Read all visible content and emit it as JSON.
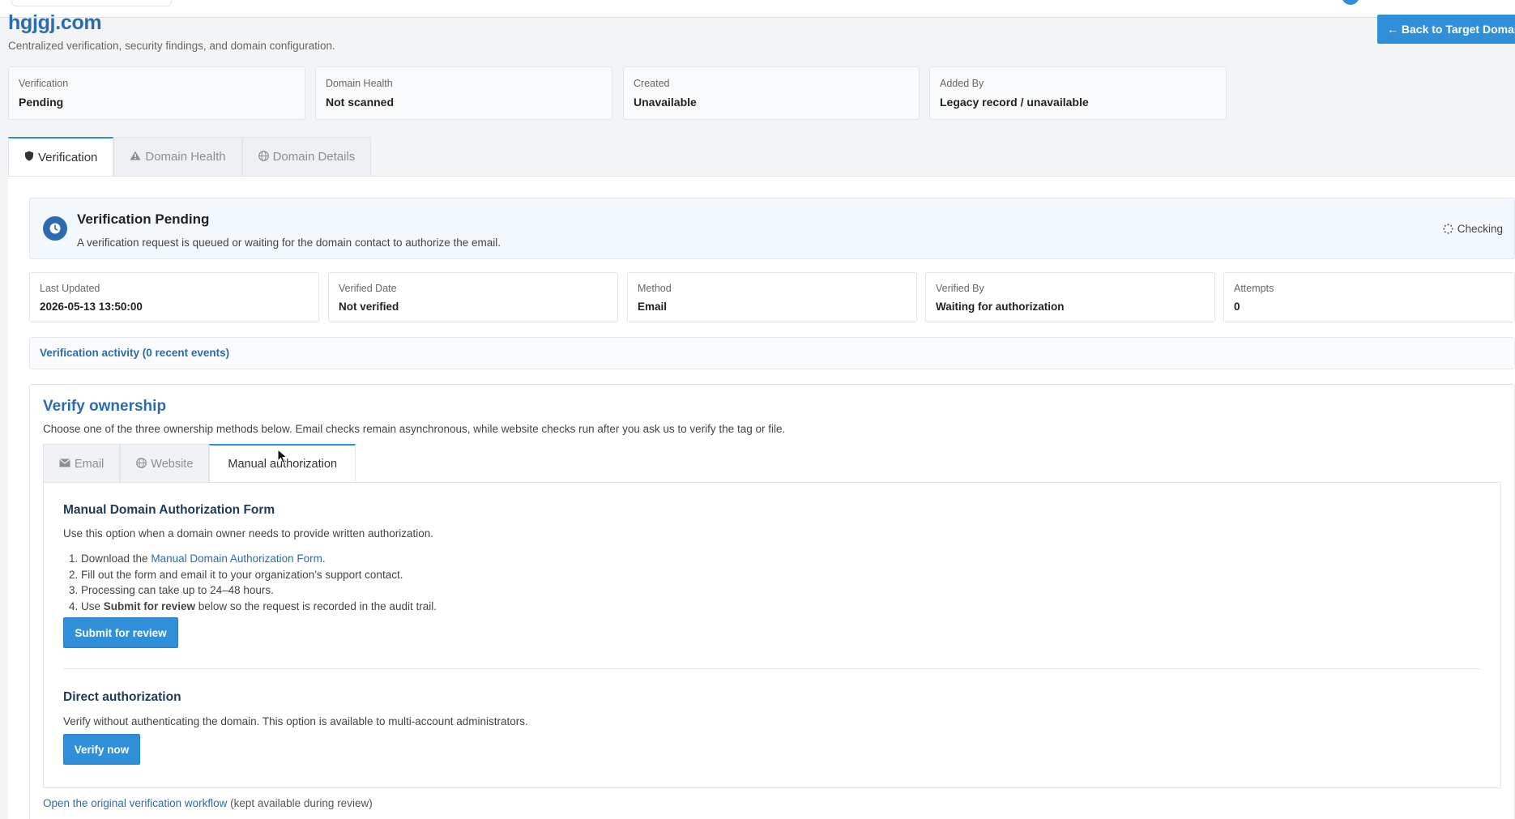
{
  "header": {
    "domain": "hgjgj.com",
    "subtitle": "Centralized verification, security findings, and domain configuration.",
    "back_button": "← Back to Target Domain"
  },
  "summary": [
    {
      "label": "Verification",
      "value": "Pending"
    },
    {
      "label": "Domain Health",
      "value": "Not scanned"
    },
    {
      "label": "Created",
      "value": "Unavailable"
    },
    {
      "label": "Added By",
      "value": "Legacy record / unavailable"
    }
  ],
  "tabs": [
    {
      "label": "Verification",
      "icon": "shield-icon"
    },
    {
      "label": "Domain Health",
      "icon": "warning-icon"
    },
    {
      "label": "Domain Details",
      "icon": "globe-icon"
    }
  ],
  "status": {
    "title": "Verification Pending",
    "description": "A verification request is queued or waiting for the domain contact to authorize the email.",
    "checking": "Checking",
    "icon": "clock-icon"
  },
  "details": [
    {
      "label": "Last Updated",
      "value": "2026-05-13 13:50:00"
    },
    {
      "label": "Verified Date",
      "value": "Not verified"
    },
    {
      "label": "Method",
      "value": "Email"
    },
    {
      "label": "Verified By",
      "value": "Waiting for authorization"
    },
    {
      "label": "Attempts",
      "value": "0"
    }
  ],
  "activity": "Verification activity (0 recent events)",
  "verify": {
    "title": "Verify ownership",
    "subtitle": "Choose one of the three ownership methods below. Email checks remain asynchronous, while website checks run after you ask us to verify the tag or file.",
    "tabs": [
      {
        "label": "Email",
        "icon": "envelope-icon"
      },
      {
        "label": "Website",
        "icon": "globe-icon"
      },
      {
        "label": "Manual authorization",
        "icon": ""
      }
    ],
    "manual": {
      "heading": "Manual Domain Authorization Form",
      "intro": "Use this option when a domain owner needs to provide written authorization.",
      "step1_prefix": "Download the ",
      "step1_link": "Manual Domain Authorization Form",
      "step1_suffix": ".",
      "step2": "Fill out the form and email it to your organization’s support contact.",
      "step3": "Processing can take up to 24–48 hours.",
      "step4_prefix": "Use ",
      "step4_bold": "Submit for review",
      "step4_suffix": " below so the request is recorded in the audit trail.",
      "submit_button": "Submit for review"
    },
    "direct": {
      "heading": "Direct authorization",
      "description": "Verify without authenticating the domain. This option is available to multi-account administrators.",
      "button": "Verify now"
    },
    "footer_link": "Open the original verification workflow",
    "footer_suffix": " (kept available during review)"
  },
  "colors": {
    "accent": "#2f8fd8",
    "title_blue": "#2b6cb0",
    "background": "#f3f4f6"
  }
}
